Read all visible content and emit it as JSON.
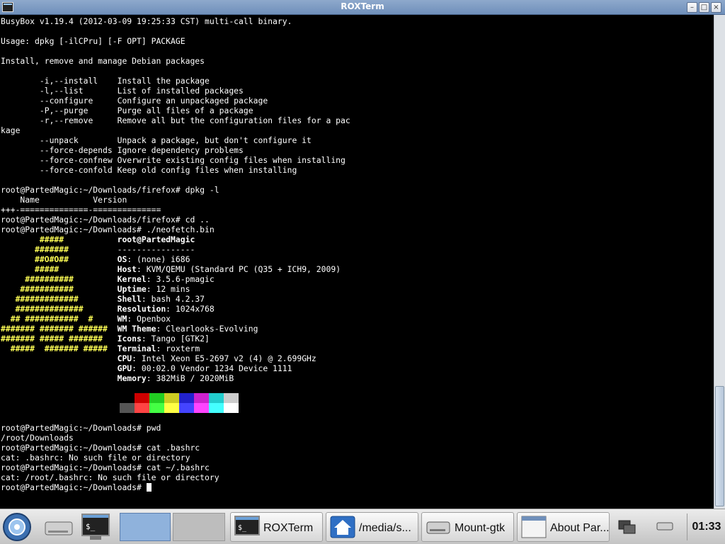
{
  "window": {
    "title": "ROXTerm"
  },
  "terminal": {
    "lines": [
      "BusyBox v1.19.4 (2012-03-09 19:25:33 CST) multi-call binary.",
      "",
      "Usage: dpkg [-ilCPru] [-F OPT] PACKAGE",
      "",
      "Install, remove and manage Debian packages",
      "",
      "        -i,--install    Install the package",
      "        -l,--list       List of installed packages",
      "        --configure     Configure an unpackaged package",
      "        -P,--purge      Purge all files of a package",
      "        -r,--remove     Remove all but the configuration files for a pac",
      "kage",
      "        --unpack        Unpack a package, but don't configure it",
      "        --force-depends Ignore dependency problems",
      "        --force-confnew Overwrite existing config files when installing",
      "        --force-confold Keep old config files when installing",
      "",
      "root@PartedMagic:~/Downloads/firefox# dpkg -l",
      "    Name           Version",
      "+++-==============-==============",
      "root@PartedMagic:~/Downloads/firefox# cd ..",
      "root@PartedMagic:~/Downloads# ./neofetch.bin"
    ],
    "neofetch": {
      "logo": [
        "        #####",
        "       #######",
        "       ##O#O##",
        "       #####",
        "     ##########",
        "    ###########",
        "   #############",
        "   ##############",
        "  ## ###########  #",
        "####### ####### ######",
        "####### ##### ####### ",
        "  #####  ####### #####"
      ],
      "user_host": "root@PartedMagic",
      "separator": "----------------",
      "info": [
        {
          "key": "OS",
          "value": "(none) i686"
        },
        {
          "key": "Host",
          "value": "KVM/QEMU (Standard PC (Q35 + ICH9, 2009)"
        },
        {
          "key": "Kernel",
          "value": "3.5.6-pmagic"
        },
        {
          "key": "Uptime",
          "value": "12 mins"
        },
        {
          "key": "Shell",
          "value": "bash 4.2.37"
        },
        {
          "key": "Resolution",
          "value": "1024x768"
        },
        {
          "key": "WM",
          "value": "Openbox"
        },
        {
          "key": "WM Theme",
          "value": "Clearlooks-Evolving"
        },
        {
          "key": "Icons",
          "value": "Tango [GTK2]"
        },
        {
          "key": "Terminal",
          "value": "roxterm"
        },
        {
          "key": "CPU",
          "value": "Intel Xeon E5-2697 v2 (4) @ 2.699GHz"
        },
        {
          "key": "GPU",
          "value": "00:02.0 Vendor 1234 Device 1111"
        },
        {
          "key": "Memory",
          "value": "382MiB / 2020MiB"
        }
      ],
      "palette_top": [
        "#000000",
        "#cc0000",
        "#22cc22",
        "#cccc22",
        "#2222cc",
        "#cc22cc",
        "#22cccc",
        "#cccccc"
      ],
      "palette_bottom": [
        "#555555",
        "#ff4444",
        "#44ff44",
        "#ffff44",
        "#4444ff",
        "#ff44ff",
        "#44ffff",
        "#ffffff"
      ]
    },
    "tail_lines": [
      "root@PartedMagic:~/Downloads# pwd",
      "/root/Downloads",
      "root@PartedMagic:~/Downloads# cat .bashrc",
      "cat: .bashrc: No such file or directory",
      "root@PartedMagic:~/Downloads# cat ~/.bashrc",
      "cat: /root/.bashrc: No such file or directory"
    ],
    "prompt": "root@PartedMagic:~/Downloads# "
  },
  "taskbar": {
    "tasks": [
      {
        "label": "ROXTerm",
        "icon": "terminal-icon"
      },
      {
        "label": "/media/s...",
        "icon": "home-folder-icon"
      },
      {
        "label": "Mount-gtk",
        "icon": "drive-icon"
      },
      {
        "label": "About Par...",
        "icon": "window-icon"
      }
    ],
    "clock": "01:33"
  }
}
